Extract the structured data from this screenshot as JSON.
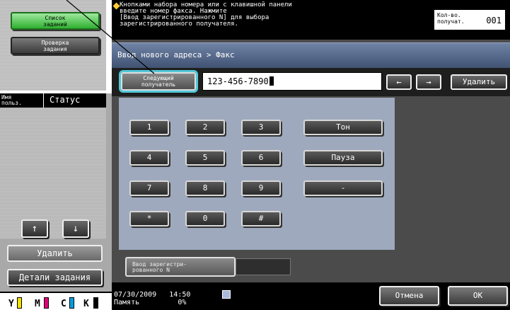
{
  "left_panel": {
    "job_list_button": "Список\nзаданий",
    "check_job_button": "Проверка\nзадания",
    "column_user": "Имя\nпольз.",
    "column_status": "Статус",
    "arrow_up": "↑",
    "arrow_down": "↓",
    "delete_button": "Удалить",
    "job_details_button": "Детали задания",
    "toner": [
      {
        "label": "Y",
        "color": "#f0e000"
      },
      {
        "label": "M",
        "color": "#e0007a"
      },
      {
        "label": "C",
        "color": "#00a0e0"
      },
      {
        "label": "K",
        "color": "#000000"
      }
    ]
  },
  "message": {
    "text": "Кнопками набора номера или с клавишной панели\nвведите номер факса. Нажмите\n[Ввод зарегистрированного N] для выбора\nзарегистрированного получателя.",
    "count_label": "Кол-во.\nполучат.",
    "count_value": "001"
  },
  "breadcrumb": "Ввод нового адреса > Факс",
  "field_row": {
    "next_recipient_button": "Следующий\nполучатель",
    "fax_number": "123-456-7890",
    "left_arrow": "←",
    "right_arrow": "→",
    "delete_button": "Удалить"
  },
  "keypad": {
    "keys": [
      "1",
      "2",
      "3",
      "4",
      "5",
      "6",
      "7",
      "8",
      "9",
      "*",
      "0",
      "#"
    ],
    "tone": "Тон",
    "pause": "Пауза",
    "dash": "-"
  },
  "registered_button": "Ввод зарегистри-\nрованного N",
  "bottom": {
    "date": "07/30/2009",
    "time": "14:50",
    "memory_label": "Память",
    "memory_value": "0%",
    "cancel_button": "Отмена",
    "ok_button": "OK"
  },
  "colors": {
    "highlight": "#52c8d8",
    "breadcrumb_bg": "#5a6f94",
    "keypad_bg": "#9ea9bd",
    "joblist_green": "#2fb02f"
  }
}
